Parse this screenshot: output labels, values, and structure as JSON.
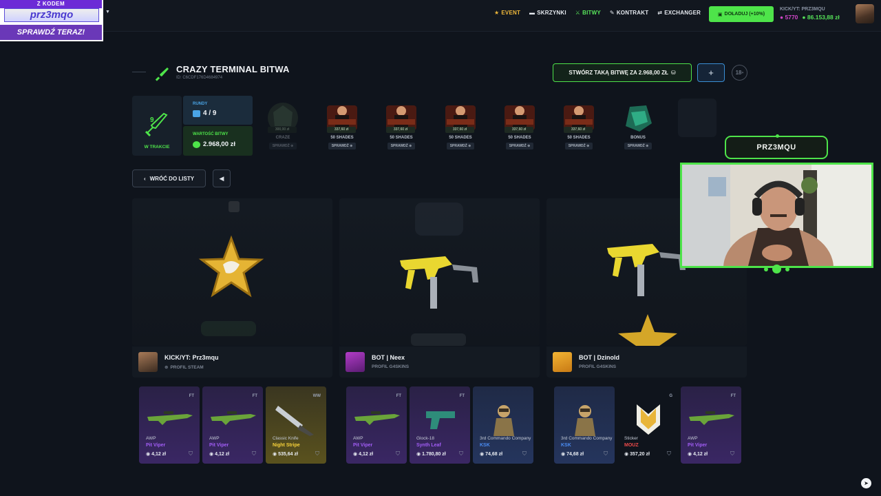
{
  "promo": {
    "line1": "Z KODEM",
    "code": "prz3mqo",
    "cta": "SPRAWDŹ TERAZ!"
  },
  "nav": {
    "items": [
      {
        "label": "EVENT",
        "icon": "star-icon"
      },
      {
        "label": "SKRZYNKI",
        "icon": "case-icon"
      },
      {
        "label": "BITWY",
        "icon": "swords-icon"
      },
      {
        "label": "KONTRAKT",
        "icon": "pen-icon"
      },
      {
        "label": "EXCHANGER",
        "icon": "exchange-icon"
      }
    ],
    "topup_label": "DOŁADUJ (+10%)",
    "username": "KICK/YT: PRZ3MQU",
    "coins": "5770",
    "balance": "86.153,88 zł"
  },
  "battle": {
    "title": "CRAZY TERMINAL BITWA",
    "id": "ID: C6CDF176D4684974",
    "create_label": "STWÓRZ TAKĄ BITWĘ ZA 2.968,00 ZŁ",
    "plus_label": "+",
    "age_badge": "18",
    "status_count": "9",
    "status_label": "W TRAKCIE",
    "rounds_label": "RUNDY",
    "rounds_value": "4 / 9",
    "value_label": "WARTOŚĆ BITWY",
    "value_amount": "2.968,00 zł"
  },
  "cases": [
    {
      "name": "CRAZE",
      "price": "300,00 zł",
      "check": "SPRAWDŹ"
    },
    {
      "name": "50 SHADES",
      "price": "337,60 zł",
      "check": "SPRAWDŹ"
    },
    {
      "name": "50 SHADES",
      "price": "337,60 zł",
      "check": "SPRAWDŹ"
    },
    {
      "name": "50 SHADES",
      "price": "337,60 zł",
      "check": "SPRAWDŹ"
    },
    {
      "name": "50 SHADES",
      "price": "337,60 zł",
      "check": "SPRAWDŹ"
    },
    {
      "name": "50 SHADES",
      "price": "337,60 zł",
      "check": "SPRAWDŹ"
    },
    {
      "name": "BONUS",
      "price": "",
      "check": "SPRAWDŹ"
    }
  ],
  "controls": {
    "back_label": "WRÓĆ DO LISTY"
  },
  "players": [
    {
      "name": "KICK/YT: Prz3mqu",
      "sub": "PROFIL STEAM"
    },
    {
      "name": "BOT | Neex",
      "sub": "PROFIL G4SKINS"
    },
    {
      "name": "BOT | Dzinold",
      "sub": "PROFIL G4SKINS"
    }
  ],
  "drops": [
    [
      {
        "cond": "FT",
        "type": "AWP",
        "skin": "Pit Viper",
        "price": "4,12 zł",
        "rarity": "purple"
      },
      {
        "cond": "FT",
        "type": "AWP",
        "skin": "Pit Viper",
        "price": "4,12 zł",
        "rarity": "purple"
      },
      {
        "cond": "WW",
        "type": "Classic Knife",
        "skin": "Night Stripe",
        "price": "535,64 zł",
        "rarity": "gold"
      }
    ],
    [
      {
        "cond": "FT",
        "type": "AWP",
        "skin": "Pit Viper",
        "price": "4,12 zł",
        "rarity": "purple"
      },
      {
        "cond": "FT",
        "type": "Glock-18",
        "skin": "Synth Leaf",
        "price": "1.780,80 zł",
        "rarity": "purple"
      },
      {
        "cond": "",
        "type": "3rd Commando Company",
        "skin": "KSK",
        "price": "74,68 zł",
        "rarity": "blue"
      }
    ],
    [
      {
        "cond": "",
        "type": "3rd Commando Company",
        "skin": "KSK",
        "price": "74,68 zł",
        "rarity": "blue"
      },
      {
        "cond": "G",
        "type": "Sticker",
        "skin": "MOUZ",
        "price": "357,20 zł",
        "rarity": "red"
      },
      {
        "cond": "FT",
        "type": "AWP",
        "skin": "Pit Viper",
        "price": "4,12 zł",
        "rarity": "purple"
      }
    ]
  ],
  "stream": {
    "cam_name": "PRZ3MQU"
  },
  "colors": {
    "accent": "#4ee44a",
    "gold": "#f0b93b",
    "rare_purple": "#a25df6",
    "rare_blue": "#4a8cf3",
    "rare_red": "#ef4a4a",
    "rare_gold": "#f7d23a"
  }
}
